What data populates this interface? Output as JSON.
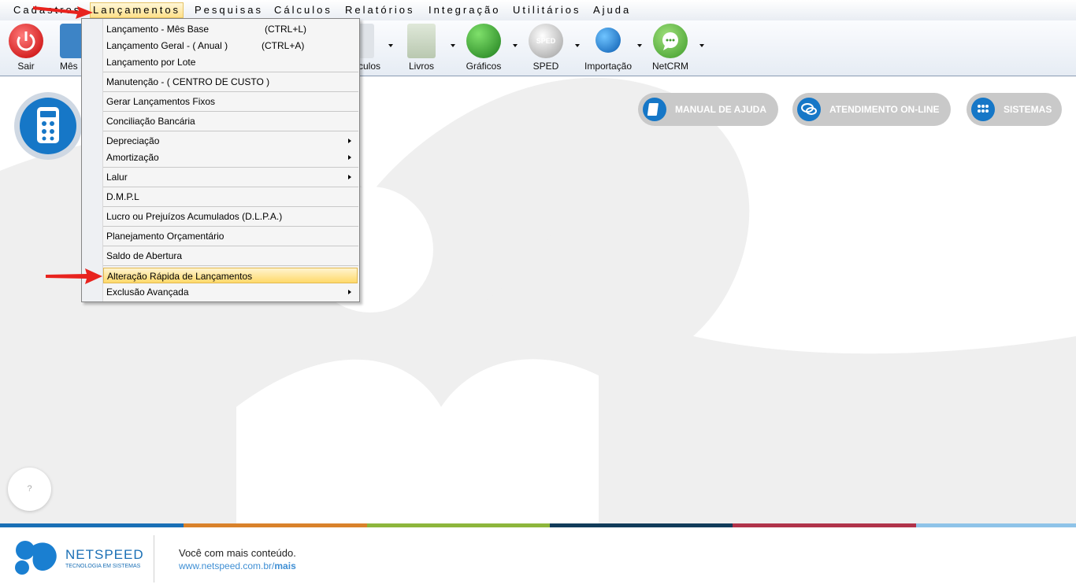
{
  "menubar": {
    "items": [
      "Cadastros",
      "Lançamentos",
      "Pesquisas",
      "Cálculos",
      "Relatórios",
      "Integração",
      "Utilitários",
      "Ajuda"
    ]
  },
  "toolbar": {
    "buttons": [
      "Sair",
      "Mês Base",
      "Cálculos",
      "Livros",
      "Gráficos",
      "SPED",
      "Importação",
      "NetCRM"
    ]
  },
  "dropdown": {
    "items": [
      {
        "label": "Lançamento - Mês Base",
        "shortcut": "(CTRL+L)"
      },
      {
        "label": "Lançamento Geral - ( Anual )",
        "shortcut": "(CTRL+A)"
      },
      {
        "label": "Lançamento por Lote"
      },
      {
        "label": "Manutenção - ( CENTRO DE CUSTO )"
      },
      {
        "label": "Gerar Lançamentos Fixos"
      },
      {
        "label": "Conciliação Bancária"
      },
      {
        "label": "Depreciação"
      },
      {
        "label": "Amortização"
      },
      {
        "label": "Lalur"
      },
      {
        "label": "D.M.P.L"
      },
      {
        "label": "Lucro ou Prejuízos Acumulados (D.L.P.A.)"
      },
      {
        "label": "Planejamento Orçamentário"
      },
      {
        "label": "Saldo de Abertura"
      },
      {
        "label": "Alteração Rápida de Lançamentos"
      },
      {
        "label": "Exclusão Avançada"
      }
    ]
  },
  "actions": {
    "manual": "MANUAL DE AJUDA",
    "atendimento": "ATENDIMENTO ON-LINE",
    "sistemas": "SISTEMAS"
  },
  "help_button": "?",
  "sped_icon_text": "SPED",
  "footer": {
    "brand": "NETSPEED",
    "tagline": "TECNOLOGIA EM SISTEMAS",
    "line1": "Você com mais conteúdo.",
    "url_prefix": "www.netspeed.com.br/",
    "url_suffix": "mais"
  },
  "colors": {
    "accent_blue": "#1677c7",
    "highlight": "#ffd96a",
    "arrow_red": "#e8231e",
    "stripe": [
      "#1a6fb5",
      "#d9822b",
      "#8db63c",
      "#123c5a",
      "#b0334a",
      "#8ec3e8"
    ]
  }
}
